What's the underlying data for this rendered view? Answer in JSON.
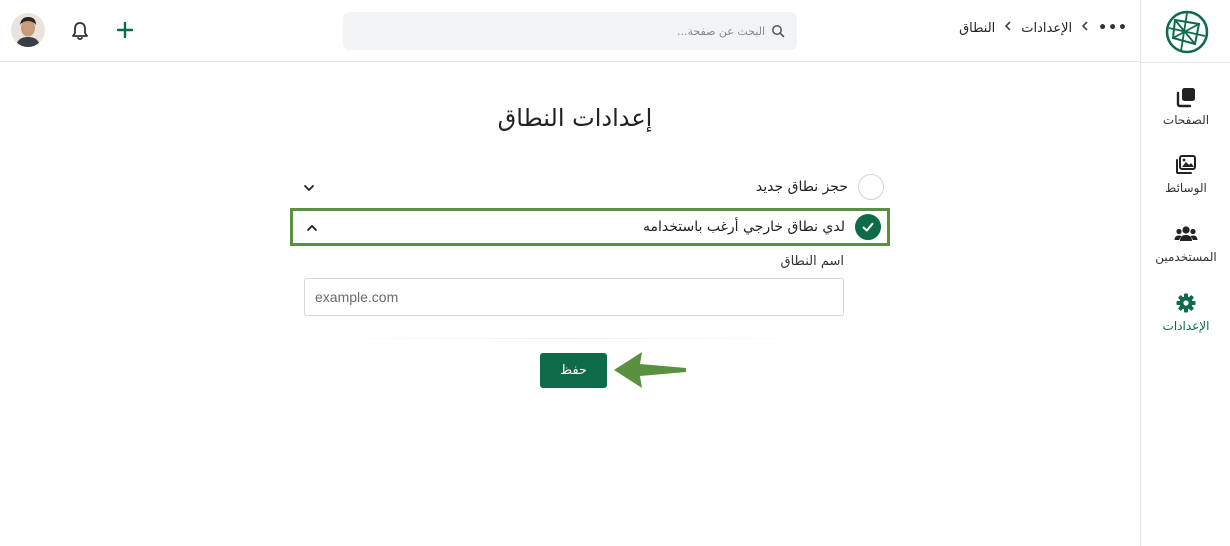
{
  "header": {
    "breadcrumb": {
      "more_label": "•••",
      "settings": "الإعدادات",
      "current": "النطاق"
    },
    "search": {
      "placeholder": "البحث عن صفحة..."
    },
    "icons": {
      "add": "plus-icon",
      "notifications": "bell-icon",
      "avatar": "user-avatar"
    }
  },
  "sidebar": {
    "items": [
      {
        "label": "الصفحات",
        "icon": "pages-icon"
      },
      {
        "label": "الوسائط",
        "icon": "media-icon"
      },
      {
        "label": "المستخدمين",
        "icon": "users-icon"
      },
      {
        "label": "الإعدادات",
        "icon": "settings-gear-icon",
        "active": true
      }
    ]
  },
  "main": {
    "title": "إعدادات النطاق",
    "options": [
      {
        "label": "حجز نطاق جديد",
        "selected": false,
        "expanded": false
      },
      {
        "label": "لدي نطاق خارجي أرغب باستخدامه",
        "selected": true,
        "expanded": true
      }
    ],
    "domain_field": {
      "label": "اسم النطاق",
      "placeholder": "example.com",
      "value": ""
    },
    "save_label": "حفظ"
  },
  "colors": {
    "brand": "#0e6b4a",
    "highlight_border": "#5a9140",
    "annotation_arrow": "#5a9140"
  }
}
